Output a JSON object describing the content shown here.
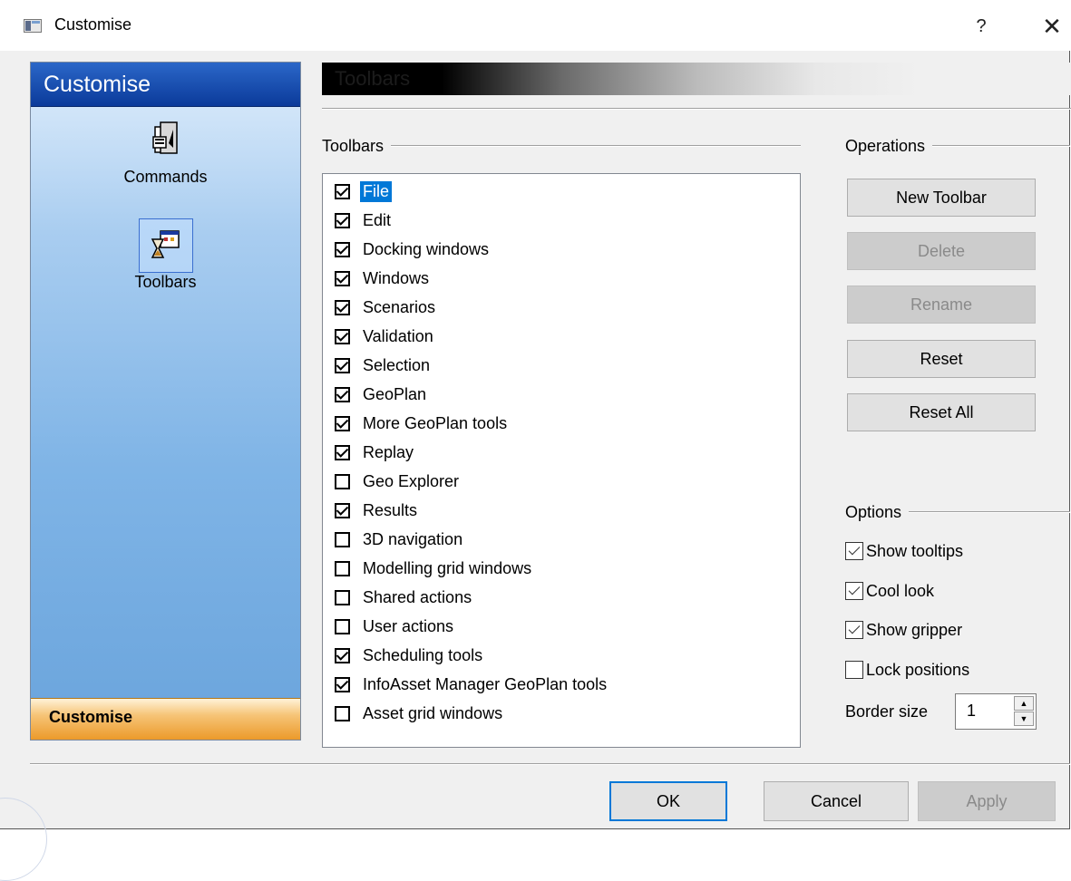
{
  "window": {
    "title": "Customise",
    "help_label": "?",
    "close_label": "✕"
  },
  "nav": {
    "header": "Customise",
    "items": [
      {
        "label": "Commands",
        "icon": "commands-icon"
      },
      {
        "label": "Toolbars",
        "icon": "toolbars-icon",
        "selected": true
      }
    ],
    "footer": "Customise"
  },
  "page": {
    "header_title": "Toolbars"
  },
  "toolbars_group": {
    "label": "Toolbars",
    "items": [
      {
        "label": "File",
        "checked": true,
        "selected": true
      },
      {
        "label": "Edit",
        "checked": true
      },
      {
        "label": "Docking windows",
        "checked": true
      },
      {
        "label": "Windows",
        "checked": true
      },
      {
        "label": "Scenarios",
        "checked": true
      },
      {
        "label": "Validation",
        "checked": true
      },
      {
        "label": "Selection",
        "checked": true
      },
      {
        "label": "GeoPlan",
        "checked": true
      },
      {
        "label": "More GeoPlan tools",
        "checked": true
      },
      {
        "label": "Replay",
        "checked": true
      },
      {
        "label": "Geo Explorer",
        "checked": false
      },
      {
        "label": "Results",
        "checked": true
      },
      {
        "label": "3D navigation",
        "checked": false
      },
      {
        "label": "Modelling grid windows",
        "checked": false
      },
      {
        "label": "Shared actions",
        "checked": false
      },
      {
        "label": "User actions",
        "checked": false
      },
      {
        "label": "Scheduling tools",
        "checked": true
      },
      {
        "label": "InfoAsset Manager GeoPlan tools",
        "checked": true
      },
      {
        "label": "Asset grid windows",
        "checked": false
      }
    ]
  },
  "operations": {
    "label": "Operations",
    "new_toolbar": "New Toolbar",
    "delete": "Delete",
    "rename": "Rename",
    "reset": "Reset",
    "reset_all": "Reset All"
  },
  "options": {
    "label": "Options",
    "show_tooltips": {
      "label": "Show tooltips",
      "checked": true
    },
    "cool_look": {
      "label": "Cool look",
      "checked": true
    },
    "show_gripper": {
      "label": "Show gripper",
      "checked": true
    },
    "lock_positions": {
      "label": "Lock positions",
      "checked": false
    },
    "border_size_label": "Border size",
    "border_size_value": "1"
  },
  "footer": {
    "ok": "OK",
    "cancel": "Cancel",
    "apply": "Apply"
  }
}
